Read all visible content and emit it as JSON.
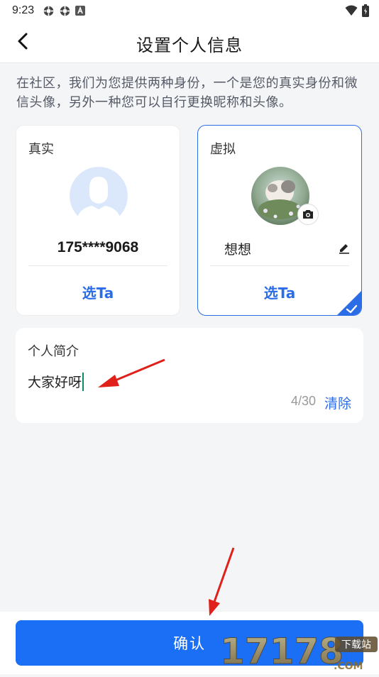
{
  "status_bar": {
    "time": "9:23",
    "icons": [
      "target-icon",
      "target-icon",
      "notification-a-icon"
    ],
    "right_icons": [
      "wifi-icon",
      "battery-icon"
    ]
  },
  "header": {
    "title": "设置个人信息",
    "back_icon": "chevron-left-icon"
  },
  "intro_text": "在社区，我们为您提供两种身份，一个是您的真实身份和微信头像，另外一种您可以自行更换昵称和头像。",
  "identity_cards": {
    "real": {
      "label": "真实",
      "phone": "175****9068",
      "choose_label": "选Ta"
    },
    "virtual": {
      "label": "虚拟",
      "nickname": "想想",
      "choose_label": "选Ta",
      "selected": true
    }
  },
  "bio": {
    "label": "个人简介",
    "value": "大家好呀",
    "count": "4/30",
    "clear_label": "清除"
  },
  "footer": {
    "confirm_label": "确认"
  },
  "watermark": {
    "text": "17178",
    "suffix": ".COM",
    "tag": "下载站"
  },
  "colors": {
    "accent": "#2b6de6",
    "button": "#1b6ff5",
    "background": "#f4f5f7",
    "annotation_arrow": "#e0201a"
  }
}
